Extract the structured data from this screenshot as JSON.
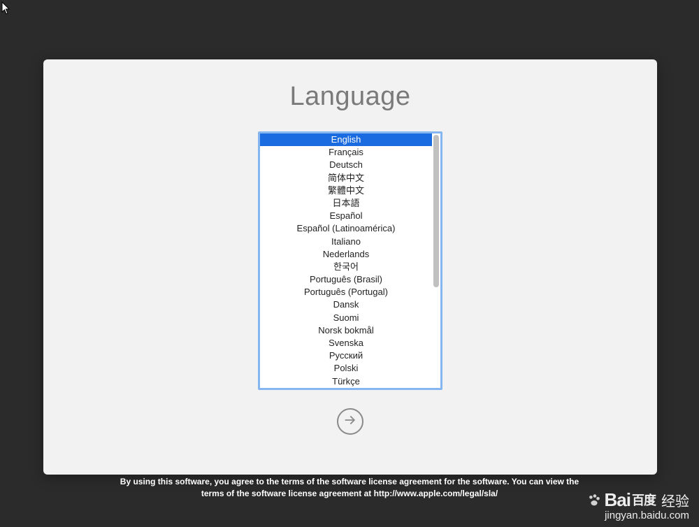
{
  "title": "Language",
  "languages": [
    "English",
    "Français",
    "Deutsch",
    "简体中文",
    "繁體中文",
    "日本語",
    "Español",
    "Español (Latinoamérica)",
    "Italiano",
    "Nederlands",
    "한국어",
    "Português (Brasil)",
    "Português (Portugal)",
    "Dansk",
    "Suomi",
    "Norsk bokmål",
    "Svenska",
    "Русский",
    "Polski",
    "Türkçe"
  ],
  "selected_index": 0,
  "license_line1": "By using this software, you agree to the terms of the software license agreement for the software. You can view the",
  "license_line2": "terms of the software license agreement at http://www.apple.com/legal/sla/",
  "watermark": {
    "brand": "Bai",
    "brand_accent": "百度",
    "suffix": "经验",
    "url": "jingyan.baidu.com"
  }
}
